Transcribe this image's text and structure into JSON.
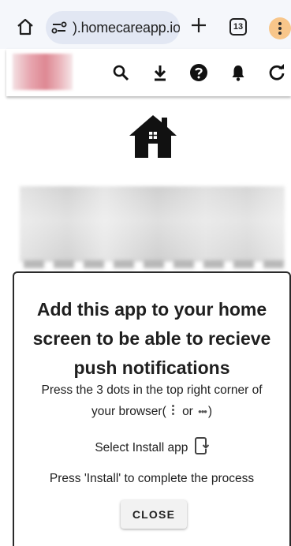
{
  "browser": {
    "url": ").homecareapp.io",
    "tab_count": "13",
    "icons": [
      "home-icon",
      "site-info-icon",
      "new-tab-icon",
      "tabs-icon",
      "browser-menu-icon"
    ],
    "menu_color": "#f8c68a"
  },
  "app_header": {
    "icons": [
      "search-icon",
      "download-icon",
      "help-icon",
      "notifications-icon",
      "refresh-icon"
    ]
  },
  "page": {
    "hero_icon": "house-icon"
  },
  "dialog": {
    "title": "Add this app to your home screen to be able to recieve push notifications",
    "line1": "Press the 3 dots in the top right corner of",
    "line2_prefix": "your browser(",
    "line2_or": "or",
    "line2_hdots": "•••",
    "line2_suffix": ")",
    "line3": "Select Install app",
    "line4": "Press 'Install' to complete the process",
    "close_label": "CLOSE"
  }
}
